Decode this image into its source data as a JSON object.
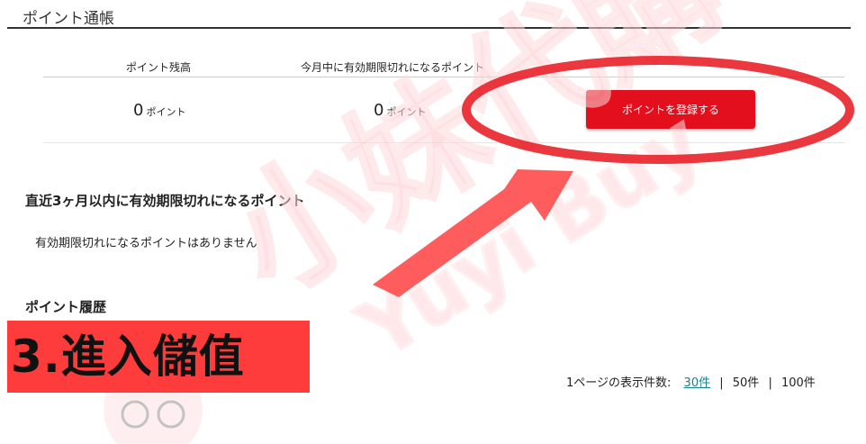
{
  "page": {
    "title": "ポイント通帳"
  },
  "summary": {
    "balance_label": "ポイント残高",
    "expiring_label": "今月中に有効期限切れになるポイント",
    "balance_value": "0",
    "balance_unit": "ポイント",
    "expiring_value": "0",
    "expiring_unit": "ポイント",
    "register_button": "ポイントを登録する"
  },
  "expiring_section": {
    "title": "直近3ヶ月以内に有効期限切れになるポイント",
    "empty_message": "有効期限切れになるポイントはありません"
  },
  "history_section": {
    "title": "ポイント履歴"
  },
  "pagination": {
    "label": "1ページの表示件数:",
    "options": [
      "30件",
      "50件",
      "100件"
    ],
    "separator": "|",
    "selected": "30件"
  },
  "overlay": {
    "step_label": "3.進入儲值",
    "watermark_cn": "小妹代購",
    "watermark_en": "Yuyi Buy",
    "accent_color": "#e8141c",
    "arrow_color": "#ff4b4b"
  }
}
